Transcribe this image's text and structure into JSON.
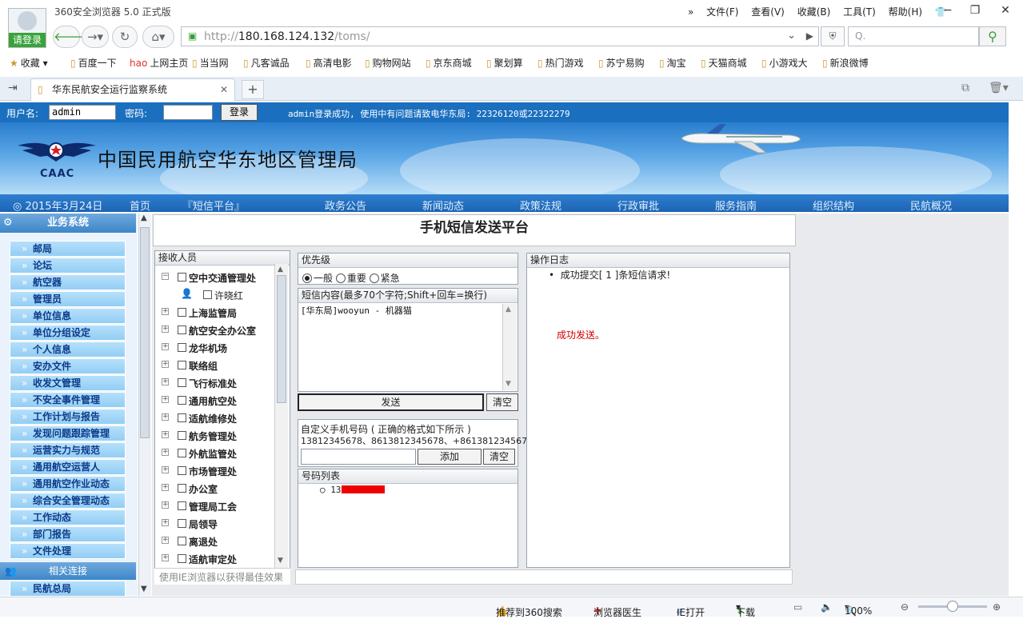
{
  "browser": {
    "title": "360安全浏览器 5.0 正式版",
    "login_prompt": "请登录",
    "menu": [
      "文件(F)",
      "查看(V)",
      "收藏(B)",
      "工具(T)",
      "帮助(H)"
    ],
    "url_prefix": "http://",
    "url_host": "180.168.124.132",
    "url_path": "/toms/",
    "search_placeholder": "Q.",
    "bookmarks": [
      "收藏",
      "百度一下",
      "上网主页",
      "当当网",
      "凡客诚品",
      "高清电影",
      "购物网站",
      "京东商城",
      "聚划算",
      "热门游戏",
      "苏宁易购",
      "淘宝",
      "天猫商城",
      "小游戏大",
      "新浪微博"
    ],
    "tab_title": "华东民航安全运行监察系统"
  },
  "login": {
    "username_label": "用户名:",
    "username_value": "admin",
    "password_label": "密码:",
    "login_button": "登录",
    "message": "admin登录成功, 使用中有问题请致电华东局: 22326120或22322279"
  },
  "header": {
    "caac": "CAAC",
    "org_name": "中国民用航空华东地区管理局",
    "date": "◎ 2015年3月24日",
    "nav": [
      "首页",
      "『短信平台』",
      "政务公告",
      "新闻动态",
      "政策法规",
      "行政审批",
      "服务指南",
      "组织结构",
      "民航概况"
    ]
  },
  "sidebar": {
    "section_title": "业务系统",
    "items": [
      "邮局",
      "论坛",
      "航空器",
      "管理员",
      "单位信息",
      "单位分组设定",
      "个人信息",
      "安办文件",
      "收发文管理",
      "不安全事件管理",
      "工作计划与报告",
      "发现问题跟踪管理",
      "运营实力与规范",
      "通用航空运营人",
      "通用航空作业动态",
      "综合安全管理动态",
      "工作动态",
      "部门报告",
      "文件处理"
    ],
    "links_title": "相关连接",
    "links": [
      "民航总局"
    ]
  },
  "sms": {
    "page_title": "手机短信发送平台",
    "recipients_title": "接收人员",
    "tree": [
      {
        "label": "空中交通管理处",
        "expand": "−",
        "level": 0
      },
      {
        "label": "许晓红",
        "expand": "",
        "level": 1
      },
      {
        "label": "上海监管局",
        "expand": "+",
        "level": 0
      },
      {
        "label": "航空安全办公室",
        "expand": "+",
        "level": 0
      },
      {
        "label": "龙华机场",
        "expand": "+",
        "level": 0
      },
      {
        "label": "联络组",
        "expand": "+",
        "level": 0
      },
      {
        "label": "飞行标准处",
        "expand": "+",
        "level": 0
      },
      {
        "label": "通用航空处",
        "expand": "+",
        "level": 0
      },
      {
        "label": "适航维修处",
        "expand": "+",
        "level": 0
      },
      {
        "label": "航务管理处",
        "expand": "+",
        "level": 0
      },
      {
        "label": "外航监管处",
        "expand": "+",
        "level": 0
      },
      {
        "label": "市场管理处",
        "expand": "+",
        "level": 0
      },
      {
        "label": "办公室",
        "expand": "+",
        "level": 0
      },
      {
        "label": "管理局工会",
        "expand": "+",
        "level": 0
      },
      {
        "label": "局领导",
        "expand": "+",
        "level": 0
      },
      {
        "label": "离退处",
        "expand": "+",
        "level": 0
      },
      {
        "label": "适航审定处",
        "expand": "+",
        "level": 0
      }
    ],
    "recipients_footer": "使用IE浏览器以获得最佳效果",
    "priority_title": "优先级",
    "priorities": [
      {
        "label": "一般",
        "checked": true
      },
      {
        "label": "重要",
        "checked": false
      },
      {
        "label": "紧急",
        "checked": false
      }
    ],
    "content_title": "短信内容(最多70个字符;Shift+回车=换行)",
    "content_value": "[华东局]wooyun - 机器猫",
    "send_button": "发送",
    "clear_button": "清空",
    "custom_title": "自定义手机号码 ( 正确的格式如下所示 )",
    "custom_example": "13812345678、8613812345678、+8613812345678",
    "add_button": "添加",
    "clear_button2": "清空",
    "numbers_title": "号码列表",
    "number_prefix": "13",
    "log_title": "操作日志",
    "log_entry": "成功提交[ 1 ]条短信请求!",
    "log_success": "成功发送。"
  },
  "status": {
    "recommend": "推荐到360搜索",
    "doctor": "浏览器医生",
    "ie_open": "IE打开",
    "download": "下载",
    "zoom": "100%"
  }
}
